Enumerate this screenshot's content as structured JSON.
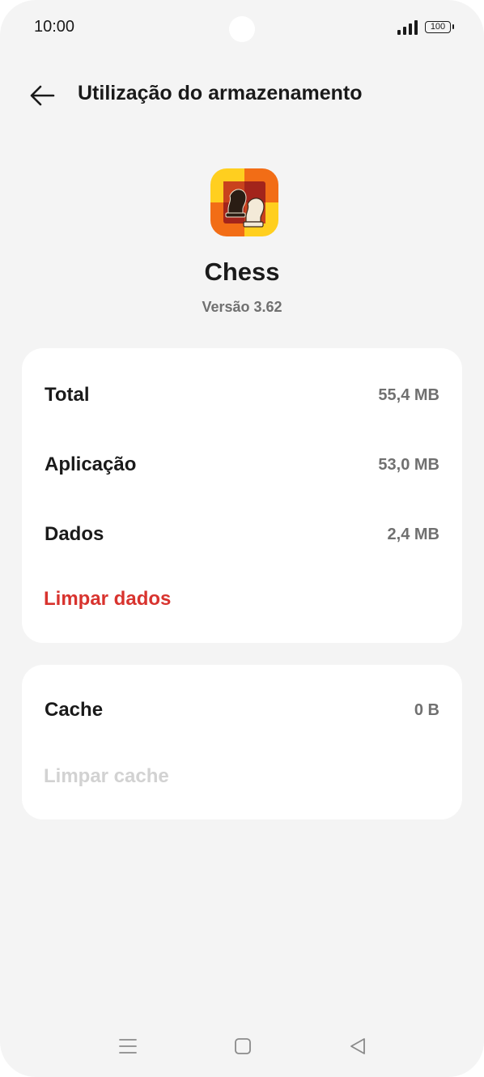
{
  "status_bar": {
    "time": "10:00",
    "battery": "100",
    "icons": [
      "signal-icon",
      "battery-icon"
    ]
  },
  "header": {
    "title": "Utilização do armazenamento",
    "back_icon": "arrow-left-icon"
  },
  "app": {
    "name": "Chess",
    "version": "Versão 3.62",
    "icon": "chess-knight-icon"
  },
  "storage": {
    "rows": [
      {
        "label": "Total",
        "value": "55,4 MB"
      },
      {
        "label": "Aplicação",
        "value": "53,0 MB"
      },
      {
        "label": "Dados",
        "value": "2,4 MB"
      }
    ],
    "clear_data_label": "Limpar dados"
  },
  "cache": {
    "label": "Cache",
    "value": "0 B",
    "clear_cache_label": "Limpar cache"
  },
  "nav": {
    "icons": [
      "menu-icon",
      "home-icon",
      "back-icon"
    ]
  },
  "colors": {
    "background": "#f4f4f4",
    "card": "#ffffff",
    "accent_red": "#d8332e",
    "disabled_text": "#d2d2d2",
    "secondary_text": "#707070",
    "primary_text": "#1a1a1a"
  }
}
